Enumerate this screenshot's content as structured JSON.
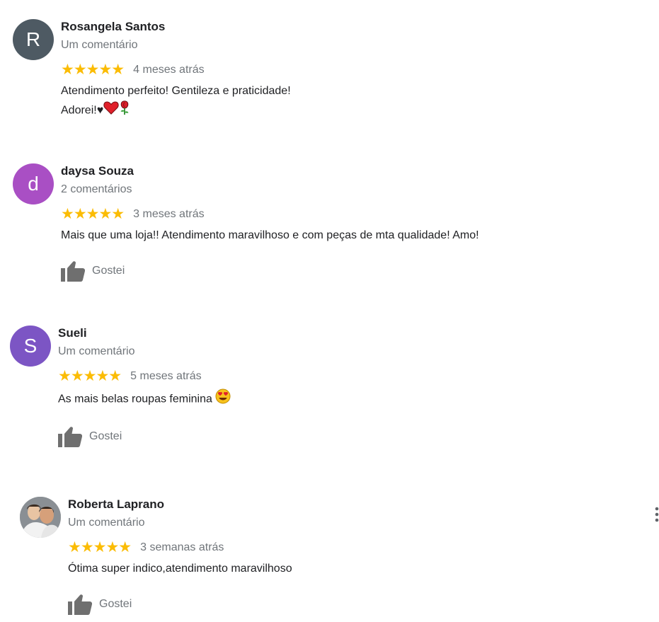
{
  "rating_color": "#fbbc04",
  "reviews": [
    {
      "avatar_letter": "R",
      "avatar_color": "#4e5a63",
      "name": "Rosangela Santos",
      "count": "Um comentário",
      "stars": "★★★★★",
      "rating": 5,
      "date": "4 meses atrás",
      "text_line1": "Atendimento perfeito! Gentileza e praticidade!",
      "text_line2": "Adorei!♥",
      "emojis": [
        "heart-icon",
        "rose-icon"
      ]
    },
    {
      "avatar_letter": "d",
      "avatar_color": "#a94fc4",
      "name": "daysa Souza",
      "count": "2 comentários",
      "stars": "★★★★★",
      "rating": 5,
      "date": "3 meses atrás",
      "text_line1": "Mais que uma loja!!  Atendimento maravilhoso e com peças de mta qualidade! Amo!",
      "like_label": "Gostei"
    },
    {
      "avatar_letter": "S",
      "avatar_color": "#7c55c4",
      "name": "Sueli",
      "count": "Um comentário",
      "stars": "★★★★★",
      "rating": 5,
      "date": "5 meses atrás",
      "text_line1": "As mais belas roupas feminina",
      "emojis": [
        "heart-eyes-emoji-icon"
      ],
      "like_label": "Gostei"
    },
    {
      "avatar_type": "photo",
      "name": "Roberta Laprano",
      "count": "Um comentário",
      "stars": "★★★★★",
      "rating": 5,
      "date": "3 semanas atrás",
      "text_line1": "Ótima super indico,atendimento maravilhoso",
      "like_label": "Gostei"
    }
  ],
  "icons": {
    "like": "thumbs-up-icon",
    "more": "more-vert-icon"
  }
}
